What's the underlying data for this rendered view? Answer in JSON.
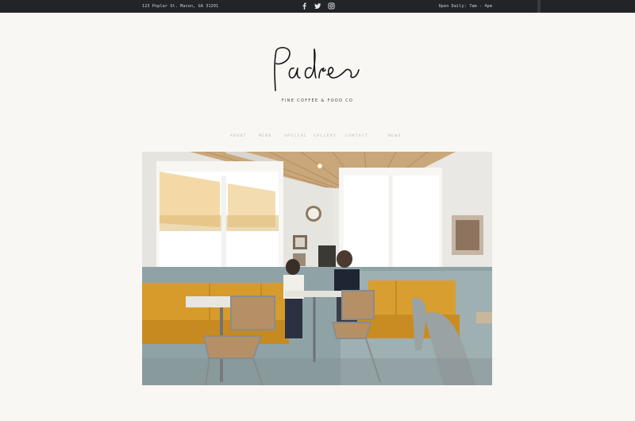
{
  "topbar": {
    "address": "123 Poplar St. Macon, GA 31201",
    "hours": "Open Daily: 7am - 4pm",
    "social_icons": [
      "facebook-icon",
      "twitter-icon",
      "instagram-icon"
    ]
  },
  "brand": {
    "logo_text": "Padre",
    "tagline": "FINE COFFEE & FOOD CO"
  },
  "nav": {
    "items": [
      "ABOUT",
      "MENU",
      "SPECIAL",
      "GALLERY",
      "CONTACT",
      "NEWS"
    ]
  },
  "colors": {
    "topbar_bg": "#232428",
    "page_bg": "#f8f7f4",
    "mustard_seat": "#d79b2c",
    "wall_blue": "#8fa3a7"
  }
}
